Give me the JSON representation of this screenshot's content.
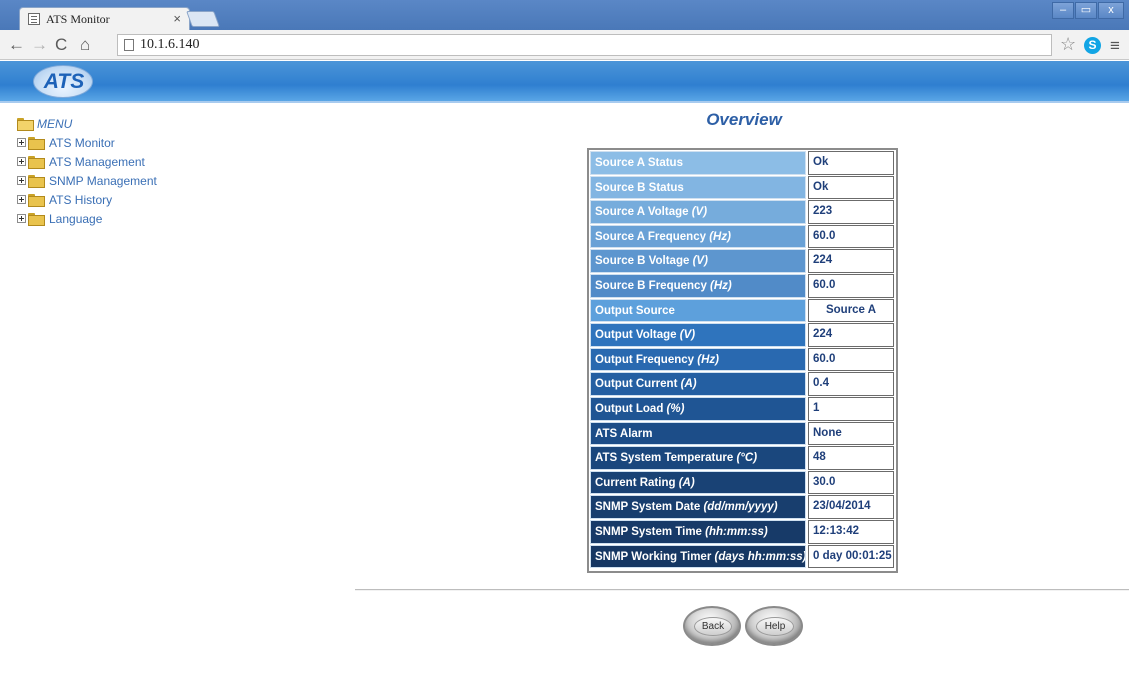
{
  "browser": {
    "tab_title": "ATS Monitor",
    "tab_close": "×",
    "address": "10.1.6.140",
    "window_controls": [
      "–",
      "▭",
      "x"
    ]
  },
  "banner": {
    "logo_text": "ATS"
  },
  "menu": {
    "root_label": "MENU",
    "items": [
      {
        "label": "ATS Monitor"
      },
      {
        "label": "ATS Management"
      },
      {
        "label": "SNMP Management"
      },
      {
        "label": "ATS History"
      },
      {
        "label": "Language"
      }
    ]
  },
  "main": {
    "heading": "Overview",
    "rows": [
      {
        "label": "Source A Status",
        "unit": "",
        "value": "Ok",
        "color": "#8cbde6"
      },
      {
        "label": "Source B Status",
        "unit": "",
        "value": "Ok",
        "color": "#82b5e2"
      },
      {
        "label": "Source A Voltage ",
        "unit": "(V)",
        "value": "223",
        "color": "#76acdc"
      },
      {
        "label": "Source A Frequency ",
        "unit": "(Hz)",
        "value": "60.0",
        "color": "#69a1d6"
      },
      {
        "label": "Source B Voltage ",
        "unit": "(V)",
        "value": "224",
        "color": "#5d96cf"
      },
      {
        "label": "Source B Frequency ",
        "unit": "(Hz)",
        "value": "60.0",
        "color": "#518bc8"
      },
      {
        "label": "Output Source",
        "unit": "",
        "value": "Source A",
        "color": "#5da0dc",
        "center": true
      },
      {
        "label": "Output Voltage ",
        "unit": "(V)",
        "value": "224",
        "color": "#2f74bd"
      },
      {
        "label": "Output Frequency ",
        "unit": "(Hz)",
        "value": "60.0",
        "color": "#2969b0"
      },
      {
        "label": "Output Current ",
        "unit": "(A)",
        "value": "0.4",
        "color": "#245fa2"
      },
      {
        "label": "Output Load ",
        "unit": "(%)",
        "value": "1",
        "color": "#1f5594"
      },
      {
        "label": "ATS Alarm",
        "unit": "",
        "value": "None",
        "color": "#1c4d88"
      },
      {
        "label": "ATS System Temperature ",
        "unit": "(°C)",
        "value": "48",
        "color": "#1a477d"
      },
      {
        "label": "Current Rating ",
        "unit": "(A)",
        "value": "30.0",
        "color": "#194275"
      },
      {
        "label": "SNMP System Date ",
        "unit": "(dd/mm/yyyy)",
        "value": "23/04/2014",
        "color": "#183e6e"
      },
      {
        "label": "SNMP System Time ",
        "unit": "(hh:mm:ss)",
        "value": "12:13:42",
        "color": "#173a68"
      },
      {
        "label": "SNMP Working Timer ",
        "unit": "(days hh:mm:ss)",
        "value": "0 day 00:01:25",
        "color": "#163763"
      }
    ]
  },
  "buttons": {
    "back_label": "Back",
    "help_label": "Help"
  }
}
